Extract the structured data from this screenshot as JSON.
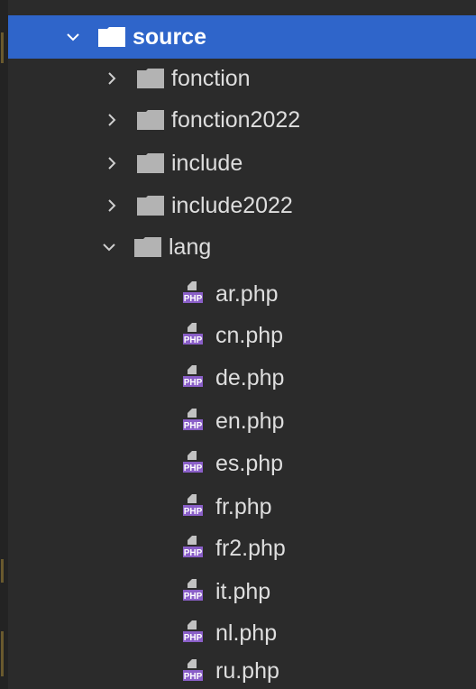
{
  "tree": {
    "root": {
      "label": "source",
      "expanded": true,
      "selected": true
    },
    "folders": [
      {
        "label": "fonction",
        "expanded": false
      },
      {
        "label": "fonction2022",
        "expanded": false
      },
      {
        "label": "include",
        "expanded": false
      },
      {
        "label": "include2022",
        "expanded": false
      },
      {
        "label": "lang",
        "expanded": true
      }
    ],
    "files": [
      {
        "label": "ar.php",
        "icon": "php-file-icon"
      },
      {
        "label": "cn.php",
        "icon": "php-file-icon"
      },
      {
        "label": "de.php",
        "icon": "php-file-icon"
      },
      {
        "label": "en.php",
        "icon": "php-file-icon"
      },
      {
        "label": "es.php",
        "icon": "php-file-icon"
      },
      {
        "label": "fr.php",
        "icon": "php-file-icon"
      },
      {
        "label": "fr2.php",
        "icon": "php-file-icon"
      },
      {
        "label": "it.php",
        "icon": "php-file-icon"
      },
      {
        "label": "nl.php",
        "icon": "php-file-icon"
      },
      {
        "label": "ru.php",
        "icon": "php-file-icon"
      }
    ],
    "php_badge_text": "PHP"
  },
  "colors": {
    "background": "#2b2b2b",
    "selection": "#2f65ca",
    "text": "#dedede",
    "folder": "#b3b3b3",
    "php_badge": "#8a5fc8"
  }
}
